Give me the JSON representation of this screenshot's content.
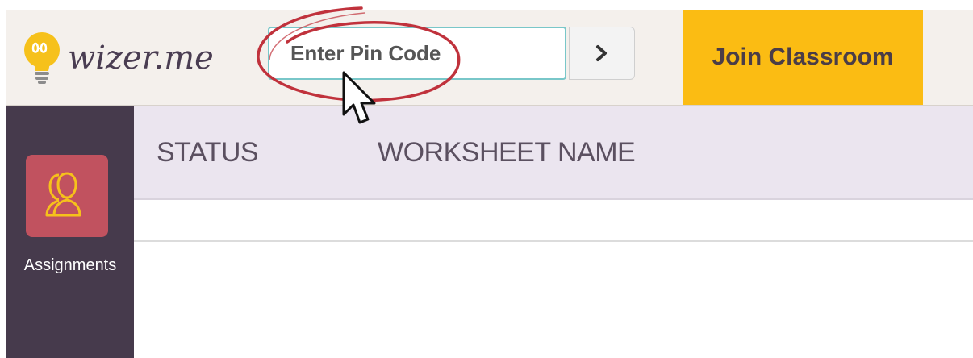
{
  "header": {
    "logo_text": "wizer.me",
    "pin_input": {
      "value": "",
      "placeholder": "Enter Pin Code"
    },
    "go_button_icon": "chevron-right-icon",
    "join_button_label": "Join Classroom"
  },
  "sidebar": {
    "items": [
      {
        "label": "Assignments",
        "icon": "users-icon",
        "active": true
      }
    ]
  },
  "table": {
    "columns": [
      "STATUS",
      "WORKSHEET NAME"
    ],
    "rows": []
  },
  "colors": {
    "header_bg": "#f4f0ec",
    "accent_yellow": "#fbbc13",
    "sidebar_bg": "#463a4c",
    "assign_tile": "#c1525f",
    "table_header_bg": "#ebe5ef",
    "input_border": "#79c7c9",
    "annotation_red": "#c0323c"
  }
}
